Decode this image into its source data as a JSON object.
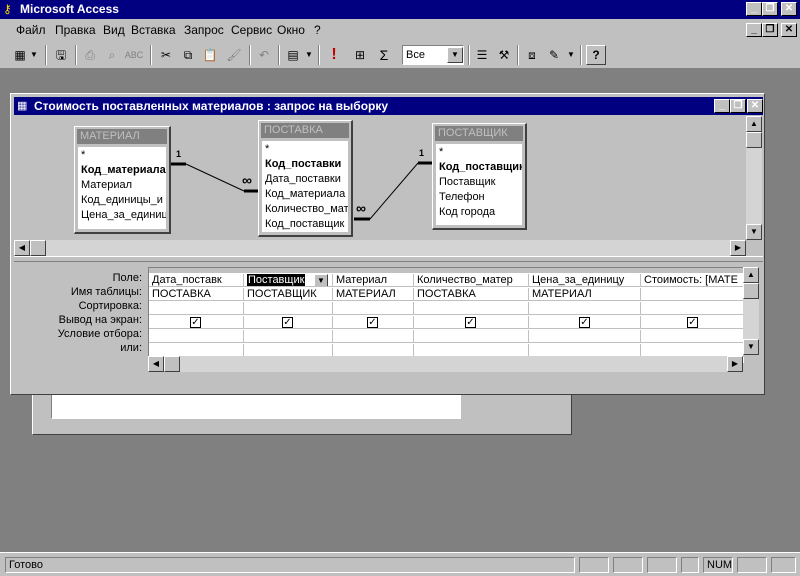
{
  "app": {
    "title": "Microsoft Access"
  },
  "menu": [
    "Файл",
    "Правка",
    "Вид",
    "Вставка",
    "Запрос",
    "Сервис",
    "Окно",
    "?"
  ],
  "toolbar": {
    "top_values": "Все"
  },
  "query_window": {
    "title": "Стоимость поставленных материалов : запрос на выборку",
    "tables": [
      {
        "name": "МАТЕРИАЛ",
        "fields": [
          "*",
          "Код_материала",
          "Материал",
          "Код_единицы_и",
          "Цена_за_единиц"
        ],
        "key_index": 1
      },
      {
        "name": "ПОСТАВКА",
        "fields": [
          "*",
          "Код_поставки",
          "Дата_поставки",
          "Код_материала",
          "Количество_мат",
          "Код_поставщик"
        ],
        "key_index": 1
      },
      {
        "name": "ПОСТАВЩИК",
        "fields": [
          "*",
          "Код_поставщик",
          "Поставщик",
          "Телефон",
          "Код города"
        ],
        "key_index": 1
      }
    ],
    "relations": [
      {
        "one": "1",
        "many": "∞"
      },
      {
        "one": "1",
        "many": "∞"
      }
    ],
    "grid": {
      "row_labels": [
        "Поле:",
        "Имя таблицы:",
        "Сортировка:",
        "Вывод на экран:",
        "Условие отбора:",
        "или:"
      ],
      "columns": [
        {
          "field": "Дата_поставк",
          "table": "ПОСТАВКА",
          "show": true
        },
        {
          "field": "Поставщик",
          "table": "ПОСТАВЩИК",
          "show": true
        },
        {
          "field": "Материал",
          "table": "МАТЕРИАЛ",
          "show": true
        },
        {
          "field": "Количество_матер",
          "table": "ПОСТАВКА",
          "show": true
        },
        {
          "field": "Цена_за_единицу",
          "table": "МАТЕРИАЛ",
          "show": true
        },
        {
          "field": "Стоимость: [МАТЕ",
          "table": "",
          "show": true
        }
      ]
    }
  },
  "status": {
    "text": "Готово",
    "num": "NUM"
  },
  "icons": {
    "app": "key-icon",
    "new": "datasheet-view-icon",
    "save": "save-icon",
    "print": "print-icon",
    "preview": "print-preview-icon",
    "spell": "spelling-icon",
    "cut": "cut-icon",
    "copy": "copy-icon",
    "paste": "paste-icon",
    "format_painter": "format-painter-icon",
    "undo": "undo-icon",
    "query_type": "query-type-icon",
    "run": "run-icon",
    "show_table": "show-table-icon",
    "totals": "totals-icon",
    "properties": "properties-icon",
    "build": "build-icon",
    "database_window": "database-window-icon",
    "new_object": "new-object-icon",
    "help": "help-icon"
  }
}
